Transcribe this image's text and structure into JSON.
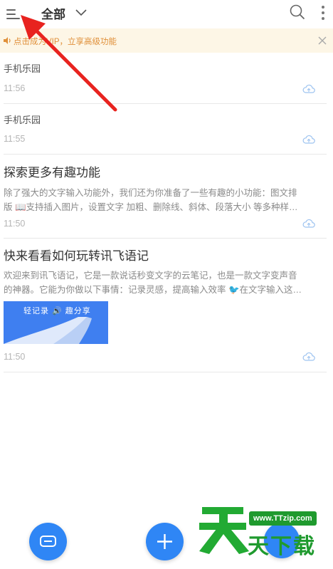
{
  "topbar": {
    "folder": "全部",
    "icons": {
      "menu": "menu-icon",
      "dropdown": "chevron-down-icon",
      "search": "search-icon",
      "more": "more-vertical-icon"
    }
  },
  "notice": {
    "text": "点击成为VIP，立享高级功能",
    "icons": {
      "speaker": "speaker-icon",
      "close": "close-icon"
    }
  },
  "notes": [
    {
      "title": "手机乐园",
      "time": "11:56"
    },
    {
      "title": "手机乐园",
      "time": "11:55"
    },
    {
      "title": "探索更多有趣功能",
      "preview": [
        "除了强大的文字输入功能外，我们还为你准备了一些有趣的小功能：图文排",
        "版 📖支持插入图片，设置文字 加粗、删除线、斜体、段落大小 等多种样…"
      ],
      "time": "11:50"
    },
    {
      "title": "快来看看如何玩转讯飞语记",
      "preview": [
        "欢迎来到讯飞语记，它是一款说话秒变文字的云笔记，也是一款文字变声音",
        "的神器。它能为你做以下事情：记录灵感，提高输入效率 🐦在文字输入这…"
      ],
      "thumbnail_text": "轻记录 🔊 趣分享",
      "time": "11:50"
    }
  ],
  "fabs": {
    "voice": "keyboard-voice-icon",
    "add": "plus-icon"
  },
  "watermark": {
    "url": "www.TTzip.com",
    "text": "天下载"
  },
  "colors": {
    "accent": "#2f86f5",
    "notice_bg": "#fdf6e6",
    "notice_text": "#e0903a",
    "annotation": "#e8231f",
    "watermark": "#1f9a2e"
  }
}
